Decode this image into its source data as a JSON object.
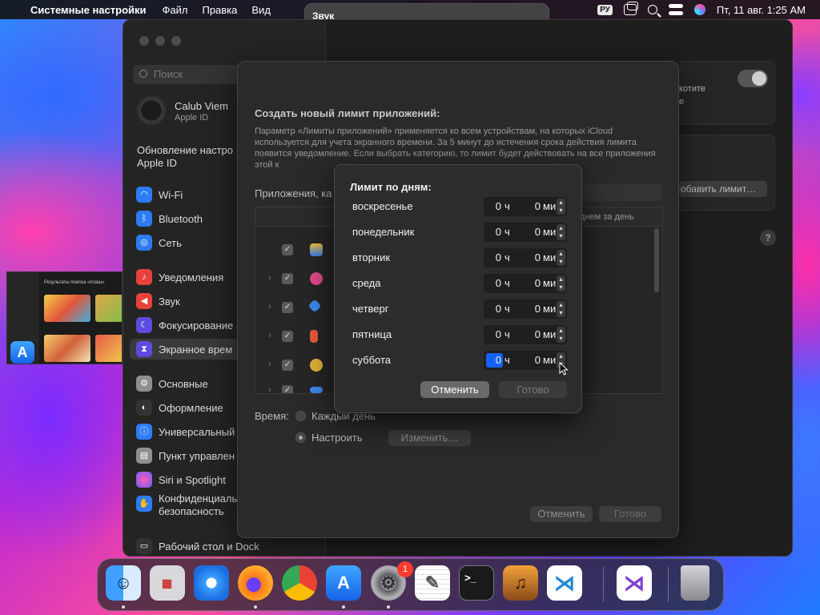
{
  "menubar": {
    "app_name": "Системные настройки",
    "items": [
      "Файл",
      "Правка",
      "Вид"
    ],
    "lang": "РУ",
    "datetime": "Пт, 11 авг. 1:25 AM"
  },
  "sound_popup": {
    "title": "Звук"
  },
  "sidebar": {
    "search_placeholder": "Поиск",
    "user_name": "Calub Viem",
    "user_sub": "Apple ID",
    "update_line1": "Обновление настро",
    "update_line2": "Apple ID",
    "items": [
      {
        "label": "Wi-Fi",
        "icon": "wifi-icon",
        "color": "#2d7cf6"
      },
      {
        "label": "Bluetooth",
        "icon": "bluetooth-icon",
        "color": "#2d7cf6"
      },
      {
        "label": "Сеть",
        "icon": "globe-icon",
        "color": "#2d7cf6"
      },
      {
        "label": "Уведомления",
        "icon": "bell-icon",
        "color": "#e8413a"
      },
      {
        "label": "Звук",
        "icon": "speaker-icon",
        "color": "#e8413a"
      },
      {
        "label": "Фокусирование",
        "icon": "moon-icon",
        "color": "#5d4be0"
      },
      {
        "label": "Экранное врем",
        "icon": "hourglass-icon",
        "color": "#5d4be0"
      },
      {
        "label": "Основные",
        "icon": "gear-icon",
        "color": "#8e8e93"
      },
      {
        "label": "Оформление",
        "icon": "appearance-icon",
        "color": "#333336"
      },
      {
        "label": "Универсальный",
        "icon": "accessibility-icon",
        "color": "#2d7cf6"
      },
      {
        "label": "Пункт управлен",
        "icon": "control-center-icon",
        "color": "#8e8e93"
      },
      {
        "label": "Siri и Spotlight",
        "icon": "siri-icon",
        "color": "#c33bd0"
      },
      {
        "label": "Конфиденциаль",
        "label2": "безопасность",
        "icon": "hand-icon",
        "color": "#2d7cf6"
      },
      {
        "label": "Рабочий стол и Dock",
        "icon": "desktop-icon",
        "color": "#333336"
      }
    ]
  },
  "sheet": {
    "title": "Создать новый лимит приложений:",
    "description": "Параметр «Лимиты приложений» применяется ко всем устройствам, на которых iCloud используется для учета экранного времени. За 5 минут до истечения срока действия лимита появится уведомление. Если выбрать категорию, то лимит будет действовать на все приложения этой к",
    "apps_label": "Приложения, ка",
    "column_header": "днем за день",
    "time_label": "Время:",
    "option_every_day": "Каждый день",
    "option_custom": "Настроить",
    "edit_button": "Изменить…",
    "cancel_button": "Отменить",
    "done_button": "Готово"
  },
  "content": {
    "right_text1": "котите",
    "right_text2": "е",
    "add_limit_button": "обавить лимит…",
    "help": "?"
  },
  "modal": {
    "title": "Лимит по дням:",
    "hour_unit": "ч",
    "minute_unit": "мин",
    "days": [
      {
        "name": "воскресенье",
        "hours": "0",
        "minutes": "0"
      },
      {
        "name": "понедельник",
        "hours": "0",
        "minutes": "0"
      },
      {
        "name": "вторник",
        "hours": "0",
        "minutes": "0"
      },
      {
        "name": "среда",
        "hours": "0",
        "minutes": "0"
      },
      {
        "name": "четверг",
        "hours": "0",
        "minutes": "0"
      },
      {
        "name": "пятница",
        "hours": "0",
        "minutes": "0"
      },
      {
        "name": "суббота",
        "hours": "0",
        "minutes": "0"
      }
    ],
    "cancel_button": "Отменить",
    "done_button": "Готово"
  },
  "thumbnail": {
    "heading": "Результаты поиска «плаш»"
  },
  "dock": {
    "apps": [
      "finder-icon",
      "launchpad-icon",
      "safari-icon",
      "firefox-icon",
      "chrome-icon",
      "app-store-icon",
      "system-settings-icon",
      "textedit-icon",
      "terminal-icon",
      "garageband-icon",
      "vscode-icon",
      "visual-studio-icon",
      "trash-icon"
    ],
    "settings_badge": "1"
  }
}
